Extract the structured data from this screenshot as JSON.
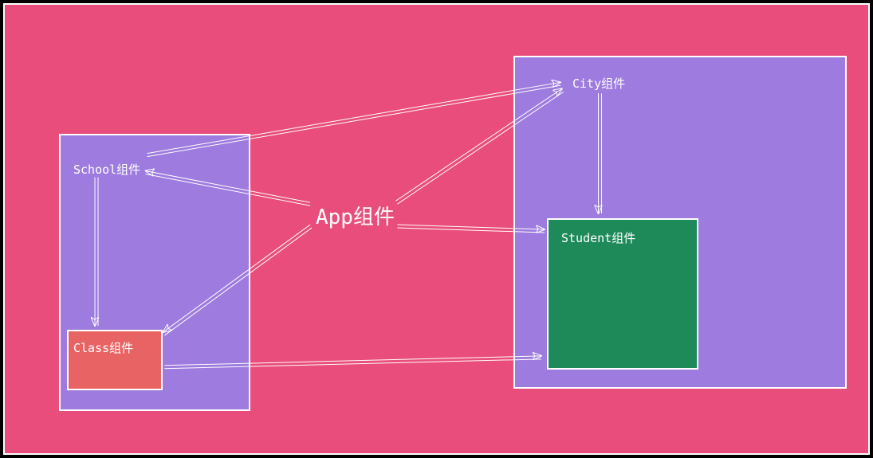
{
  "diagram": {
    "app_label": "App组件",
    "school_label": "School组件",
    "city_label": "City组件",
    "class_label": "Class组件",
    "student_label": "Student组件"
  },
  "colors": {
    "background": "#e94d7c",
    "purple_box": "#9e7bde",
    "red_box": "#e86464",
    "green_box": "#1e8a5a",
    "border": "#ffffff",
    "text": "#ffffff"
  },
  "structure": {
    "root": "App组件",
    "children": [
      {
        "name": "School组件",
        "children": [
          {
            "name": "Class组件"
          }
        ]
      },
      {
        "name": "City组件",
        "children": [
          {
            "name": "Student组件"
          }
        ]
      }
    ]
  }
}
